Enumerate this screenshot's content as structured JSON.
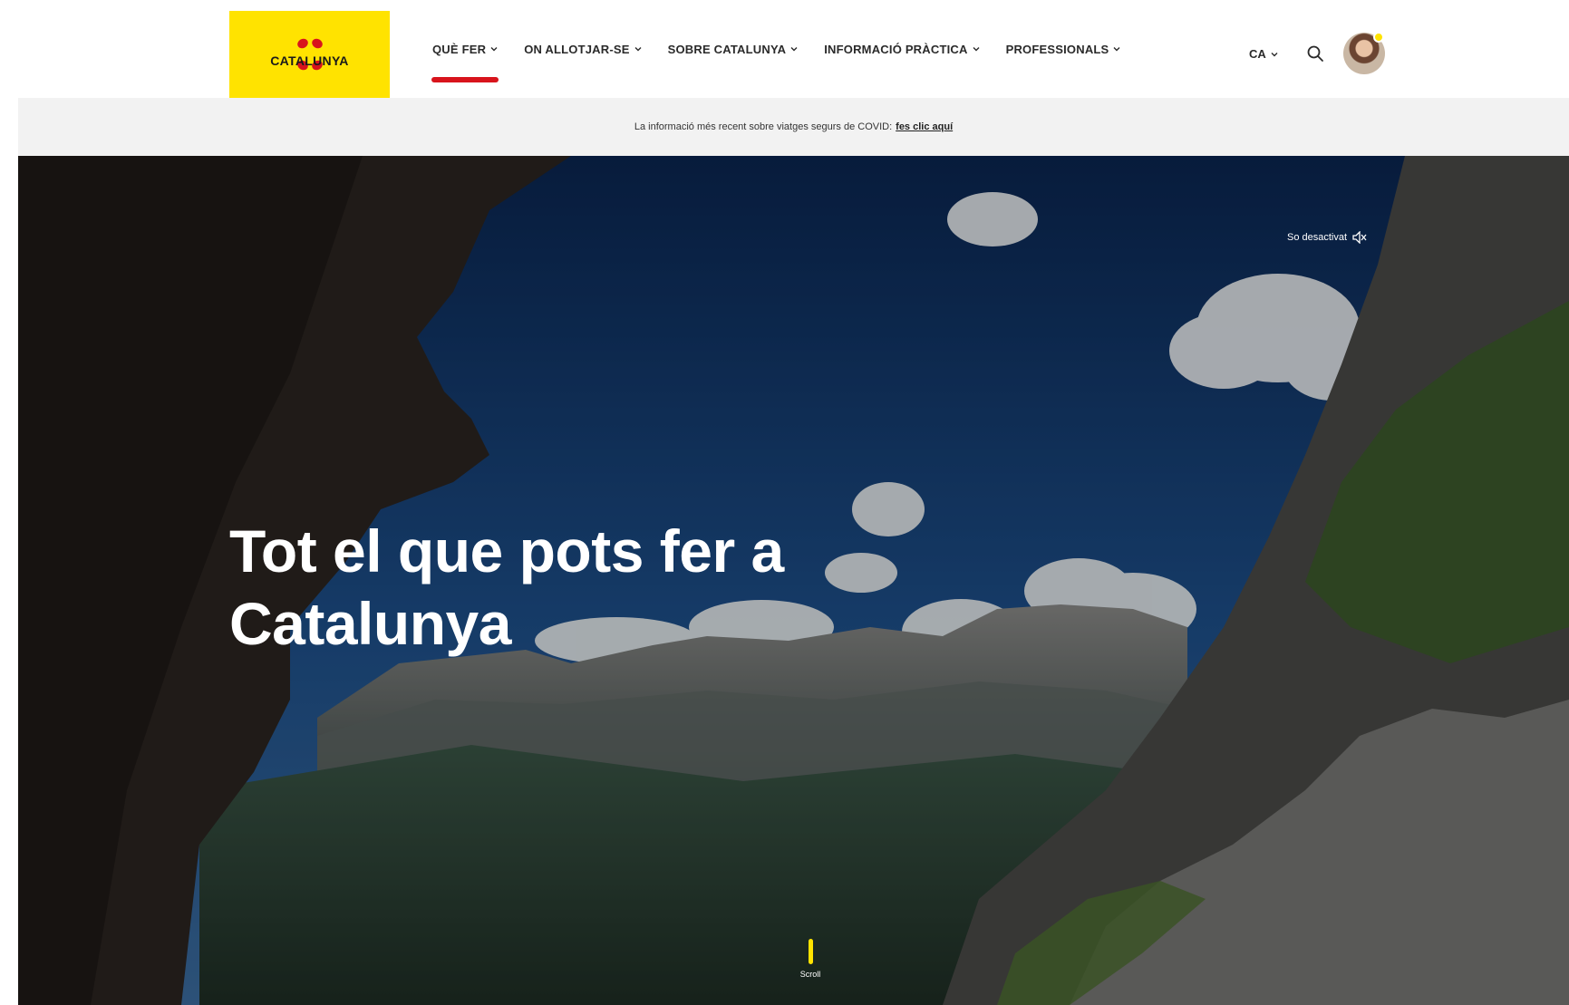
{
  "header": {
    "logo_text": "CATALUNYA",
    "nav": [
      {
        "label": "QUÈ FER",
        "active": true
      },
      {
        "label": "ON ALLOTJAR-SE",
        "active": false
      },
      {
        "label": "SOBRE CATALUNYA",
        "active": false
      },
      {
        "label": "INFORMACIÓ PRÀCTICA",
        "active": false
      },
      {
        "label": "PROFESSIONALS",
        "active": false
      }
    ],
    "language": "CA",
    "icons": {
      "search": "search-icon",
      "avatar": "user-avatar",
      "chevron": "chevron-down-icon"
    }
  },
  "notice": {
    "text": "La informació més recent sobre viatges segurs de COVID:",
    "link": "fes clic aquí"
  },
  "hero": {
    "title": "Tot el que pots fer a Catalunya",
    "sound_toggle": "So desactivat",
    "scroll_label": "Scroll"
  },
  "colors": {
    "brand_yellow": "#ffe300",
    "active_red": "#d8141c",
    "notice_bg": "#f2f2f2"
  }
}
